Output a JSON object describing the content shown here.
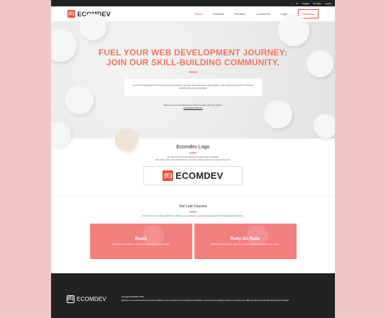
{
  "topbar": {
    "facebook": "f",
    "twitter": "🐦",
    "links": [
      "English",
      "My Page",
      "Logout"
    ]
  },
  "nav": {
    "logo_mark": "{E}",
    "logo_text": "ECOMDEV",
    "items": [
      "About",
      "Features",
      "Reviews",
      "Contact Us",
      "Login",
      "Ecomdev"
    ]
  },
  "hero": {
    "title_line1": "FUEL YOUR WEB DEVELOPMENT JOURNEY:",
    "title_line2": "JOIN OUR SKILL-BUILDING COMMUNITY.",
    "card_text": "Join our web development community and fuel your journey to success. Access resources, expert guidance, and a supportive network to unlock your potential in this ever-evolving field.",
    "contact_text": "Please contact us per Email for any further questions about the program",
    "email": "contact@ecomdev.com"
  },
  "logo_section": {
    "title": "Ecomdev Logo",
    "text_line1": "The logo of ecomdev was decided through the logo competition.",
    "text_line2": "After online public voting and Selection Committee's judging process, the logo won the prize.",
    "logo_mark": "{E}",
    "logo_text": "ECOMDEV"
  },
  "courses": {
    "title": "Our Last Courses",
    "subtitle": "Our latest courses in React and Ruby on Rails are your gateway to mastering these powerful web development frameworks.",
    "items": [
      {
        "title": "React",
        "desc": "Master the Power of React: Unleash Your Web Development Potential"
      },
      {
        "title": "Ruby On Rails",
        "desc": "Building Web Applications with Ruby on Rails: Empower Your Development Journey"
      }
    ]
  },
  "footer": {
    "logo_mark": "{E}",
    "logo_text": "ECOMDEV",
    "copyright": "Copyright ECOMDEV 2023.",
    "desc": "Welcome to our web development courses! Whether you're a beginner or an experienced developer, our courses are designed to help you enhance your skills and stay up-to-date with the latest technologies."
  }
}
